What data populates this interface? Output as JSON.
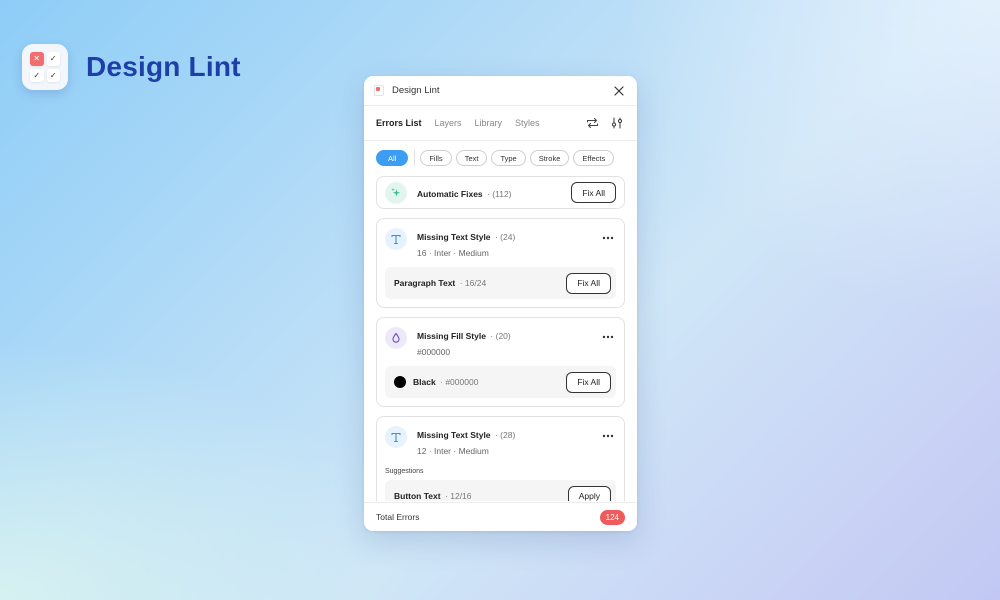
{
  "brand": {
    "title": "Design Lint"
  },
  "window": {
    "title": "Design Lint"
  },
  "tabs": [
    {
      "label": "Errors List",
      "active": true
    },
    {
      "label": "Layers",
      "active": false
    },
    {
      "label": "Library",
      "active": false
    },
    {
      "label": "Styles",
      "active": false
    }
  ],
  "filters": [
    {
      "label": "All",
      "active": true
    },
    {
      "label": "Fills",
      "active": false
    },
    {
      "label": "Text",
      "active": false
    },
    {
      "label": "Type",
      "active": false
    },
    {
      "label": "Stroke",
      "active": false
    },
    {
      "label": "Effects",
      "active": false
    }
  ],
  "automatic": {
    "title": "Automatic Fixes",
    "count": "· (112)",
    "button": "Fix All"
  },
  "errors": [
    {
      "title": "Missing Text Style",
      "count": "· (24)",
      "sub": "16 · Inter · Medium",
      "row_label": "Paragraph Text",
      "row_meta": "· 16/24",
      "button": "Fix All"
    },
    {
      "title": "Missing Fill Style",
      "count": "· (20)",
      "sub": "#000000",
      "row_label": "Black",
      "row_meta": "· #000000",
      "button": "Fix All"
    },
    {
      "title": "Missing Text Style",
      "count": "· (28)",
      "sub": "12 · Inter · Medium",
      "suggestions_label": "Suggestions",
      "row_label": "Button Text",
      "row_meta": "· 12/16",
      "button": "Apply"
    }
  ],
  "footer": {
    "label": "Total Errors",
    "count": "124"
  },
  "colors": {
    "accent": "#3d9df2",
    "error": "#ef5a5a",
    "brand": "#1f3fa8"
  }
}
